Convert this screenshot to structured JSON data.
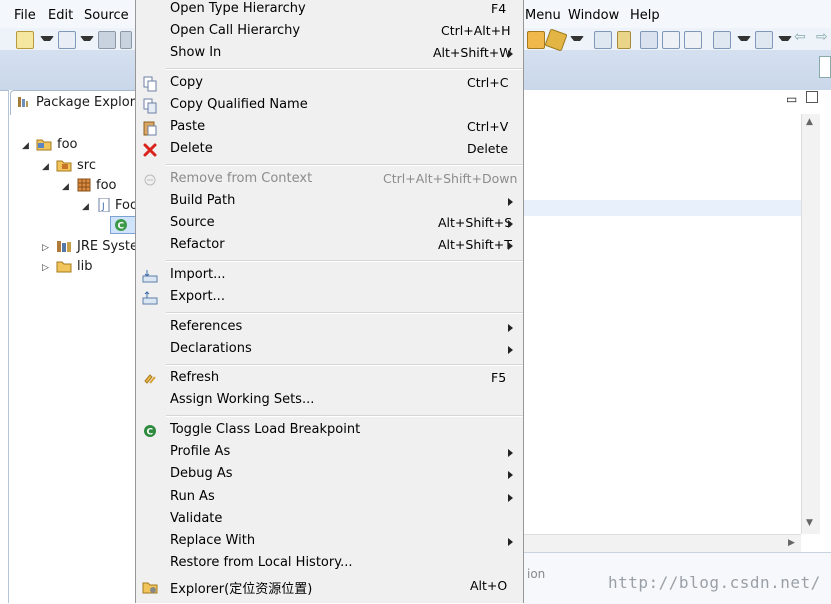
{
  "menubar": {
    "left": [
      "File",
      "Edit",
      "Source"
    ],
    "right": [
      "Menu",
      "Window",
      "Help"
    ]
  },
  "package_explorer": {
    "tab_label": "Package Explore",
    "tree": [
      {
        "label": "foo",
        "icon": "project-icon"
      },
      {
        "label": "src",
        "icon": "source-folder-icon"
      },
      {
        "label": "foo",
        "icon": "package-icon"
      },
      {
        "label": "Foo",
        "icon": "java-file-icon"
      },
      {
        "label": "",
        "icon": "class-icon"
      },
      {
        "label": "JRE Syster",
        "icon": "library-icon"
      },
      {
        "label": "lib",
        "icon": "folder-icon"
      }
    ]
  },
  "context_menu": {
    "items": [
      {
        "label": "Open Type Hierarchy",
        "shortcut": "F4"
      },
      {
        "label": "Open Call Hierarchy",
        "shortcut": "Ctrl+Alt+H"
      },
      {
        "label": "Show In",
        "shortcut": "Alt+Shift+W"
      },
      {
        "label": "Copy",
        "shortcut": "Ctrl+C"
      },
      {
        "label": "Copy Qualified Name",
        "shortcut": ""
      },
      {
        "label": "Paste",
        "shortcut": "Ctrl+V"
      },
      {
        "label": "Delete",
        "shortcut": "Delete"
      },
      {
        "label": "Remove from Context",
        "shortcut": "Ctrl+Alt+Shift+Down"
      },
      {
        "label": "Build Path",
        "shortcut": ""
      },
      {
        "label": "Source",
        "shortcut": "Alt+Shift+S"
      },
      {
        "label": "Refactor",
        "shortcut": "Alt+Shift+T"
      },
      {
        "label": "Import...",
        "shortcut": ""
      },
      {
        "label": "Export...",
        "shortcut": ""
      },
      {
        "label": "References",
        "shortcut": ""
      },
      {
        "label": "Declarations",
        "shortcut": ""
      },
      {
        "label": "Refresh",
        "shortcut": "F5"
      },
      {
        "label": "Assign Working Sets...",
        "shortcut": ""
      },
      {
        "label": "Toggle Class Load Breakpoint",
        "shortcut": ""
      },
      {
        "label": "Profile As",
        "shortcut": ""
      },
      {
        "label": "Debug As",
        "shortcut": ""
      },
      {
        "label": "Run As",
        "shortcut": ""
      },
      {
        "label": "Validate",
        "shortcut": ""
      },
      {
        "label": "Replace With",
        "shortcut": ""
      },
      {
        "label": "Restore from Local History...",
        "shortcut": ""
      },
      {
        "label": "Explorer(定位资源位置)",
        "shortcut": "Alt+O"
      }
    ]
  },
  "bottom_panel": {
    "partial_label": "ion"
  },
  "watermark": "http://blog.csdn.net/",
  "colors": {
    "menu_bg": "#f0f0f0",
    "toolbar_bg": "#d3dfee",
    "delete_red": "#d9241c",
    "breakpoint_green": "#2e8b3d"
  }
}
